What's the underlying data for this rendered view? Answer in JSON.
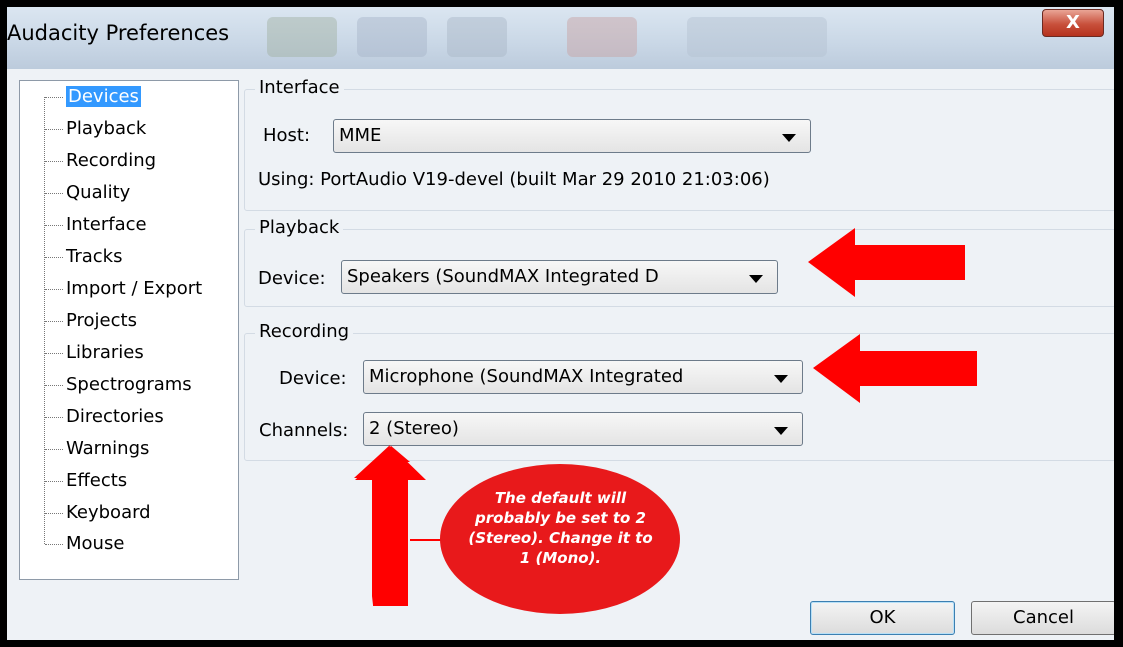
{
  "window": {
    "title": "Audacity Preferences",
    "close_glyph": "X"
  },
  "sidebar": {
    "items": [
      {
        "label": "Devices",
        "selected": true
      },
      {
        "label": "Playback"
      },
      {
        "label": "Recording"
      },
      {
        "label": "Quality"
      },
      {
        "label": "Interface"
      },
      {
        "label": "Tracks"
      },
      {
        "label": "Import / Export"
      },
      {
        "label": "Projects"
      },
      {
        "label": "Libraries"
      },
      {
        "label": "Spectrograms"
      },
      {
        "label": "Directories"
      },
      {
        "label": "Warnings"
      },
      {
        "label": "Effects"
      },
      {
        "label": "Keyboard"
      },
      {
        "label": "Mouse"
      }
    ]
  },
  "interface_group": {
    "title": "Interface",
    "host_label": "Host:",
    "host_value": "MME",
    "using_text": "Using: PortAudio V19-devel (built Mar 29 2010 21:03:06)"
  },
  "playback_group": {
    "title": "Playback",
    "device_label": "Device:",
    "device_value": "Speakers (SoundMAX Integrated D"
  },
  "recording_group": {
    "title": "Recording",
    "device_label": "Device:",
    "device_value": "Microphone (SoundMAX Integrated",
    "channels_label": "Channels:",
    "channels_value": "2 (Stereo)"
  },
  "buttons": {
    "ok": "OK",
    "cancel": "Cancel"
  },
  "annotation": {
    "callout_text": "The default will probably be set to 2 (Stereo).  Change it to 1 (Mono).",
    "arrow_color": "#ff0000"
  },
  "colors": {
    "selection": "#3399ff",
    "callout": "#e8191b"
  }
}
